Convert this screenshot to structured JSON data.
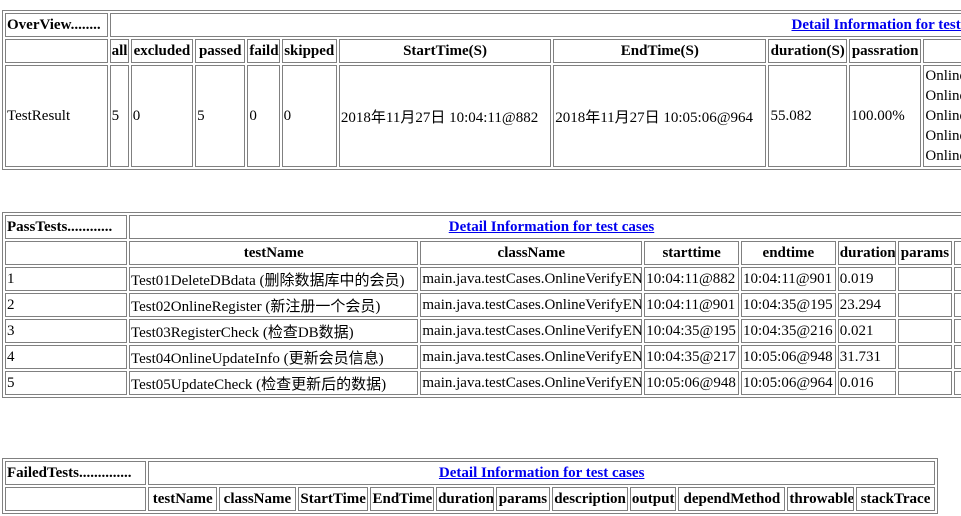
{
  "overview": {
    "section_label": "OverView........",
    "detail_link": "Detail Information for test cases",
    "headers": [
      "all",
      "excluded",
      "passed",
      "faild",
      "skipped",
      "StartTime(S)",
      "EndTime(S)",
      "duration(S)",
      "passration"
    ],
    "row_label": "TestResult",
    "values": [
      "5",
      "0",
      "5",
      "0",
      "0",
      "2018年11月27日 10:04:11@882",
      "2018年11月27日 10:05:06@964",
      "55.082",
      "100.00%"
    ],
    "online_list": [
      "Online",
      "Online",
      "Online",
      "Online",
      "Online"
    ]
  },
  "pass_tests": {
    "section_label": "PassTests............",
    "detail_link": "Detail Information for test cases",
    "headers": [
      "testName",
      "className",
      "starttime",
      "endtime",
      "duration",
      "params"
    ],
    "rows": [
      {
        "index": "1",
        "testName": "Test01DeleteDBdata (删除数据库中的会员)",
        "className": "main.java.testCases.OnlineVerifyEN",
        "starttime": "10:04:11@882",
        "endtime": "10:04:11@901",
        "duration": "0.019",
        "params": ""
      },
      {
        "index": "2",
        "testName": "Test02OnlineRegister (新注册一个会员)",
        "className": "main.java.testCases.OnlineVerifyEN",
        "starttime": "10:04:11@901",
        "endtime": "10:04:35@195",
        "duration": "23.294",
        "params": ""
      },
      {
        "index": "3",
        "testName": "Test03RegisterCheck (检查DB数据)",
        "className": "main.java.testCases.OnlineVerifyEN",
        "starttime": "10:04:35@195",
        "endtime": "10:04:35@216",
        "duration": "0.021",
        "params": ""
      },
      {
        "index": "4",
        "testName": "Test04OnlineUpdateInfo (更新会员信息)",
        "className": "main.java.testCases.OnlineVerifyEN",
        "starttime": "10:04:35@217",
        "endtime": "10:05:06@948",
        "duration": "31.731",
        "params": ""
      },
      {
        "index": "5",
        "testName": "Test05UpdateCheck (检查更新后的数据)",
        "className": "main.java.testCases.OnlineVerifyEN",
        "starttime": "10:05:06@948",
        "endtime": "10:05:06@964",
        "duration": "0.016",
        "params": ""
      }
    ]
  },
  "failed_tests": {
    "section_label": "FailedTests..............",
    "detail_link": "Detail Information for test cases",
    "headers": [
      "testName",
      "className",
      "StartTime",
      "EndTime",
      "duration",
      "params",
      "description",
      "output",
      "dependMethod",
      "throwable",
      "stackTrace"
    ]
  }
}
